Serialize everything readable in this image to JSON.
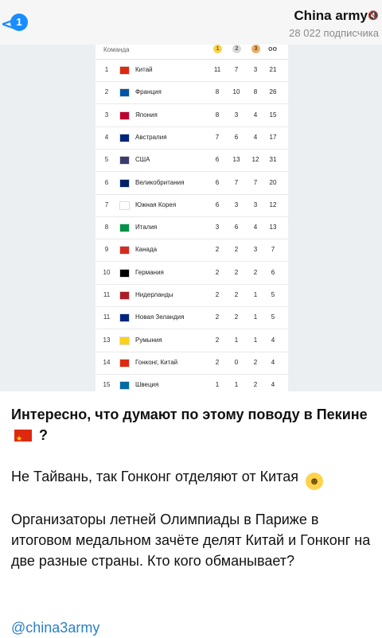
{
  "header": {
    "back_glyph": "<",
    "unread_count": "1",
    "channel_title": "China army",
    "subscribers": "28 022 подписчика"
  },
  "table": {
    "header_team": "Команда",
    "medal_labels": [
      "1",
      "2",
      "3",
      "oo"
    ],
    "rows": [
      {
        "rank": "1",
        "country": "Китай",
        "gold": "11",
        "silver": "7",
        "bronze": "3",
        "total": "21",
        "flag_color": "#de2910"
      },
      {
        "rank": "2",
        "country": "Франция",
        "gold": "8",
        "silver": "10",
        "bronze": "8",
        "total": "26",
        "flag_color": "#0055a4"
      },
      {
        "rank": "3",
        "country": "Япония",
        "gold": "8",
        "silver": "3",
        "bronze": "4",
        "total": "15",
        "flag_color": "#bc002d"
      },
      {
        "rank": "4",
        "country": "Австралия",
        "gold": "7",
        "silver": "6",
        "bronze": "4",
        "total": "17",
        "flag_color": "#00247d"
      },
      {
        "rank": "5",
        "country": "США",
        "gold": "6",
        "silver": "13",
        "bronze": "12",
        "total": "31",
        "flag_color": "#3c3b6e"
      },
      {
        "rank": "6",
        "country": "Великобритания",
        "gold": "6",
        "silver": "7",
        "bronze": "7",
        "total": "20",
        "flag_color": "#012169"
      },
      {
        "rank": "7",
        "country": "Южная Корея",
        "gold": "6",
        "silver": "3",
        "bronze": "3",
        "total": "12",
        "flag_color": "#ffffff"
      },
      {
        "rank": "8",
        "country": "Италия",
        "gold": "3",
        "silver": "6",
        "bronze": "4",
        "total": "13",
        "flag_color": "#009246"
      },
      {
        "rank": "9",
        "country": "Канада",
        "gold": "2",
        "silver": "2",
        "bronze": "3",
        "total": "7",
        "flag_color": "#d52b1e"
      },
      {
        "rank": "10",
        "country": "Германия",
        "gold": "2",
        "silver": "2",
        "bronze": "2",
        "total": "6",
        "flag_color": "#000000"
      },
      {
        "rank": "11",
        "country": "Нидерланды",
        "gold": "2",
        "silver": "2",
        "bronze": "1",
        "total": "5",
        "flag_color": "#ae1c28"
      },
      {
        "rank": "11",
        "country": "Новая Зеландия",
        "gold": "2",
        "silver": "2",
        "bronze": "1",
        "total": "5",
        "flag_color": "#00247d"
      },
      {
        "rank": "13",
        "country": "Румыния",
        "gold": "2",
        "silver": "1",
        "bronze": "1",
        "total": "4",
        "flag_color": "#fcd116"
      },
      {
        "rank": "14",
        "country": "Гонконг, Китай",
        "gold": "2",
        "silver": "0",
        "bronze": "2",
        "total": "4",
        "flag_color": "#de2910"
      },
      {
        "rank": "15",
        "country": "Швеция",
        "gold": "1",
        "silver": "1",
        "bronze": "2",
        "total": "4",
        "flag_color": "#006aa7"
      }
    ]
  },
  "post": {
    "line1": "Интересно, что думают по этому поводу в Пекине",
    "line1_end": "?",
    "line2": "Не Тайвань, так Гонконг отделяют от Китая",
    "line3": "Организаторы летней Олимпиады в Париже в итоговом медальном зачёте делят Китай и Гонконг на две разные страны. Кто кого обманывает?",
    "signature": "@china3army"
  },
  "icons": {
    "mute": "muted-speaker-icon",
    "china_flag": "china-flag-icon",
    "grin": "grinning-face-icon"
  }
}
